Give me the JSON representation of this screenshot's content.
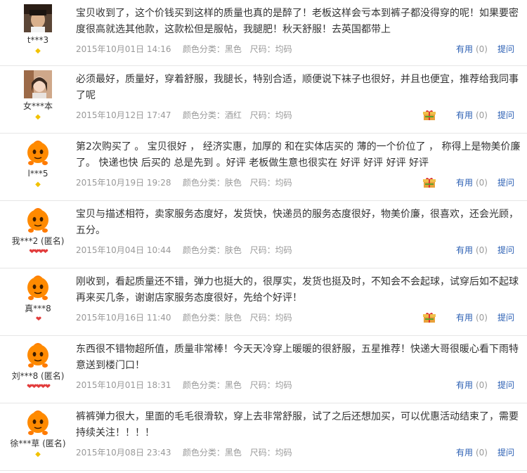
{
  "reviews": [
    {
      "user": "t***3",
      "avatar": "photo-avatar-dark",
      "rank": "gem",
      "text": "宝贝收到了，这个价钱买到这样的质量也真的是醉了！老板这样会亏本到裤子都没得穿的呢！如果要密度很高就选其他款，这款松但是服帖，我腿肥！秋天舒服！去英国都带上",
      "date": "2015年10月01日 14:16",
      "color": "颜色分类：黑色",
      "size": "尺码：均码",
      "gift": false,
      "useful_label": "有用",
      "useful_count": "(0)",
      "ask_label": "提问"
    },
    {
      "user": "女***本",
      "avatar": "photo-avatar-girl",
      "rank": "gem",
      "text": "必须最好，质量好，穿着舒服，我腿长，特别合适，顺便说下袜子也很好，并且也便宜，推荐给我同事了呢",
      "date": "2015年10月12日 17:47",
      "color": "颜色分类：酒红",
      "size": "尺码：均码",
      "gift": true,
      "useful_label": "有用",
      "useful_count": "(0)",
      "ask_label": "提问"
    },
    {
      "user": "l***5",
      "avatar": "default-orange-avatar",
      "rank": "gem",
      "text": "第2次购买了 。 宝贝很好 ， 经济实惠，加厚的 和在实体店买的 薄的一个价位了 ， 称得上是物美价廉 了。 快递也快 后买的 总是先到 。好评 老板做生意也很实在 好评 好评 好评 好评",
      "date": "2015年10月19日 19:28",
      "color": "颜色分类：肤色",
      "size": "尺码：均码",
      "gift": true,
      "useful_label": "有用",
      "useful_count": "(0)",
      "ask_label": "提问"
    },
    {
      "user": "我***2 (匿名)",
      "avatar": "default-orange-avatar",
      "rank": "heart4",
      "text": "宝贝与描述相符，卖家服务态度好，发货快，快递员的服务态度很好，物美价廉，很喜欢，还会光顾，五分。",
      "date": "2015年10月04日 10:44",
      "color": "颜色分类：肤色",
      "size": "尺码：均码",
      "gift": false,
      "useful_label": "有用",
      "useful_count": "(0)",
      "ask_label": "提问"
    },
    {
      "user": "真***8",
      "avatar": "default-orange-avatar",
      "rank": "heart1",
      "text": "刚收到，看起质量还不错，弹力也挺大的，很厚实，发货也挺及时，不知会不会起球，试穿后如不起球再来买几条，谢谢店家服务态度很好，先给个好评！",
      "date": "2015年10月16日 11:40",
      "color": "颜色分类：肤色",
      "size": "尺码：均码",
      "gift": true,
      "useful_label": "有用",
      "useful_count": "(0)",
      "ask_label": "提问"
    },
    {
      "user": "刘***8 (匿名)",
      "avatar": "default-orange-avatar",
      "rank": "heart5",
      "text": "东西很不错物超所值，质量非常棒！今天天冷穿上暖暖的很舒服，五星推荐！快递大哥很暖心看下雨特意送到楼门口！",
      "date": "2015年10月01日 18:31",
      "color": "颜色分类：黑色",
      "size": "尺码：均码",
      "gift": false,
      "useful_label": "有用",
      "useful_count": "(0)",
      "ask_label": "提问"
    },
    {
      "user": "徐***草 (匿名)",
      "avatar": "default-orange-avatar",
      "rank": "gem",
      "text": "裤裤弹力很大，里面的毛毛很滑软，穿上去非常舒服，试了之后还想加买，可以优惠活动结束了，需要持续关注！！！！",
      "date": "2015年10月08日 23:43",
      "color": "颜色分类：黑色",
      "size": "尺码：均码",
      "gift": false,
      "useful_label": "有用",
      "useful_count": "(0)",
      "ask_label": "提问"
    }
  ]
}
